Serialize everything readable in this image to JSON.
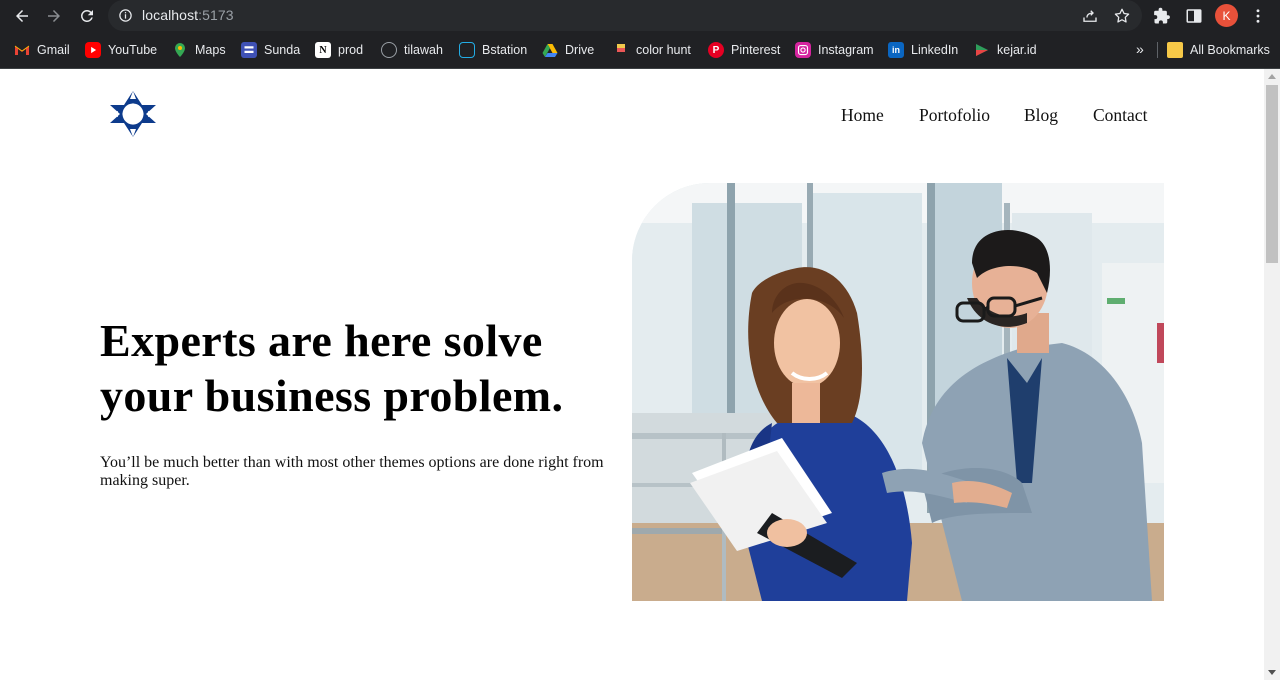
{
  "browser": {
    "url_host": "localhost",
    "url_port": ":5173",
    "profile_initial": "K",
    "bookmarks": [
      {
        "label": "Gmail",
        "icon": "gmail-icon",
        "color": "#ea4335"
      },
      {
        "label": "YouTube",
        "icon": "youtube-icon",
        "color": "#ff0000"
      },
      {
        "label": "Maps",
        "icon": "maps-icon",
        "color": "#34a853"
      },
      {
        "label": "Sunda",
        "icon": "sunda-icon",
        "color": "#3f51b5"
      },
      {
        "label": "prod",
        "icon": "notion-icon",
        "color": "#ffffff"
      },
      {
        "label": "tilawah",
        "icon": "tilawah-icon",
        "color": "#9aa0a6"
      },
      {
        "label": "Bstation",
        "icon": "bstation-icon",
        "color": "#23ade5"
      },
      {
        "label": "Drive",
        "icon": "drive-icon",
        "color": "#fbbc04"
      },
      {
        "label": "color hunt",
        "icon": "colorhunt-icon",
        "color": "#f2c94c"
      },
      {
        "label": "Pinterest",
        "icon": "pinterest-icon",
        "color": "#e60023"
      },
      {
        "label": "Instagram",
        "icon": "instagram-icon",
        "color": "#d6249f"
      },
      {
        "label": "LinkedIn",
        "icon": "linkedin-icon",
        "color": "#0a66c2"
      },
      {
        "label": "kejar.id",
        "icon": "kejar-icon",
        "color": "#2e9e5b"
      }
    ],
    "more_label": "»",
    "all_bookmarks": "All Bookmarks"
  },
  "site": {
    "nav": [
      "Home",
      "Portofolio",
      "Blog",
      "Contact"
    ],
    "hero": {
      "title": "Experts are here solve your business problem.",
      "subtitle": "You’ll be much better than with most other themes options are done right from making super."
    },
    "brand_color": "#0d3b8c"
  }
}
